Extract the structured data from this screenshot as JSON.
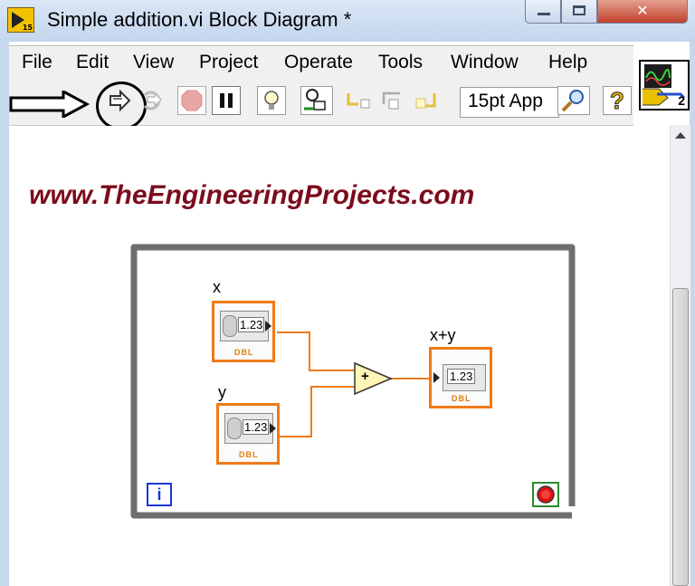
{
  "window": {
    "title": "Simple addition.vi Block Diagram *",
    "app_icon_badge": "15"
  },
  "menu": [
    "File",
    "Edit",
    "View",
    "Project",
    "Operate",
    "Tools",
    "Window",
    "Help"
  ],
  "toolbar": {
    "font_selector": "15pt App",
    "buttons": [
      "run-arrow-icon",
      "run-continuously-icon",
      "abort-icon",
      "pause-icon",
      "highlight-execution-icon",
      "retain-wire-values-icon",
      "step-into-icon",
      "step-over-icon",
      "step-out-icon",
      "search-icon",
      "context-help-icon"
    ],
    "help_glyph": "?"
  },
  "vi_icon": {
    "badge": "2"
  },
  "diagram": {
    "watermark": "www.TheEngineeringProjects.com",
    "x_label": "x",
    "y_label": "y",
    "sum_label": "x+y",
    "control_value": "1.23",
    "indicator_value": "1.23",
    "type_tag": "DBL",
    "add_symbol": "+",
    "iteration_symbol": "i",
    "colors": {
      "wire": "#f07a16",
      "loop": "#6e6e6e",
      "accent": "#7b0c1c"
    }
  }
}
